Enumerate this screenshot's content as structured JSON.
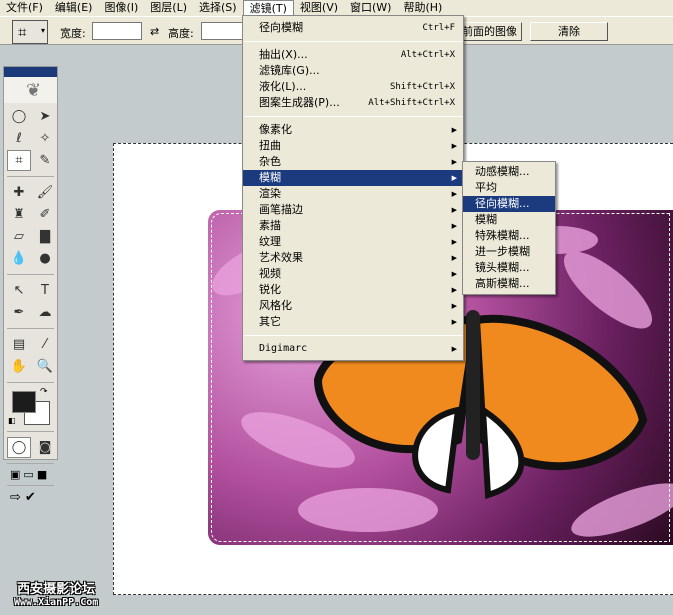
{
  "menubar": [
    "文件(F)",
    "编辑(E)",
    "图像(I)",
    "图层(L)",
    "选择(S)",
    "滤镜(T)",
    "视图(V)",
    "窗口(W)",
    "帮助(H)"
  ],
  "options": {
    "width_label": "宽度:",
    "height_label": "高度:",
    "front_image_button": "前面的图像",
    "clear_button": "清除",
    "width_value": "",
    "height_value": ""
  },
  "filter_menu": {
    "last_filter": {
      "label": "径向模糊",
      "shortcut": "Ctrl+F"
    },
    "group1": [
      {
        "label": "抽出(X)...",
        "shortcut": "Alt+Ctrl+X"
      },
      {
        "label": "滤镜库(G)...",
        "shortcut": ""
      },
      {
        "label": "液化(L)...",
        "shortcut": "Shift+Ctrl+X"
      },
      {
        "label": "图案生成器(P)...",
        "shortcut": "Alt+Shift+Ctrl+X"
      }
    ],
    "group2": [
      "像素化",
      "扭曲",
      "杂色",
      "模糊",
      "渲染",
      "画笔描边",
      "素描",
      "纹理",
      "艺术效果",
      "视频",
      "锐化",
      "风格化",
      "其它"
    ],
    "digimarc": "Digimarc"
  },
  "blur_submenu": [
    "动感模糊...",
    "平均",
    "径向模糊...",
    "模糊",
    "特殊模糊...",
    "进一步模糊",
    "镜头模糊...",
    "高斯模糊..."
  ],
  "watermark": {
    "line1": "西安摄影论坛",
    "line2": "Www.XianPP.Com"
  },
  "colors": {
    "highlight": "#1c3b7e",
    "menu_bg": "#ece9d8"
  }
}
